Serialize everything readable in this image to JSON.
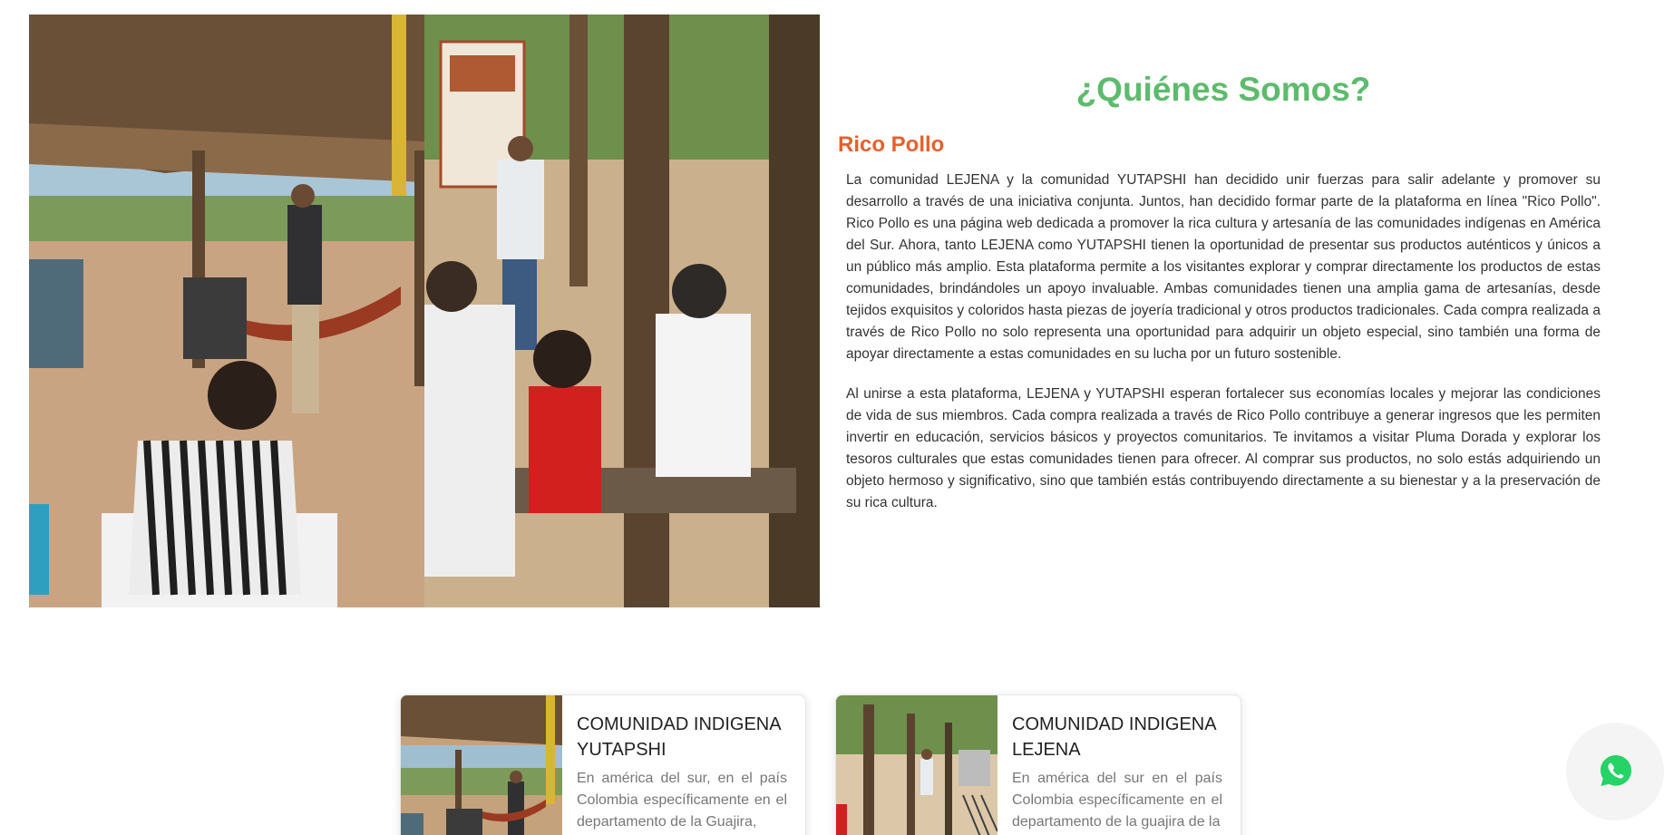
{
  "about": {
    "title": "¿Quiénes Somos?",
    "subtitle": "Rico Pollo",
    "paragraphs": [
      "La comunidad LEJENA y la comunidad YUTAPSHI han decidido unir fuerzas para salir adelante y promover su desarrollo a través de una iniciativa conjunta. Juntos, han decidido formar parte de la plataforma en línea \"Rico Pollo\". Rico Pollo es una página web dedicada a promover la rica cultura y artesanía de las comunidades indígenas en América del Sur. Ahora, tanto LEJENA como YUTAPSHI tienen la oportunidad de presentar sus productos auténticos y únicos a un público más amplio. Esta plataforma permite a los visitantes explorar y comprar directamente los productos de estas comunidades, brindándoles un apoyo invaluable. Ambas comunidades tienen una amplia gama de artesanías, desde tejidos exquisitos y coloridos hasta piezas de joyería tradicional y otros productos tradicionales. Cada compra realizada a través de Rico Pollo no solo representa una oportunidad para adquirir un objeto especial, sino también una forma de apoyar directamente a estas comunidades en su lucha por un futuro sostenible.",
      "Al unirse a esta plataforma, LEJENA y YUTAPSHI esperan fortalecer sus economías locales y mejorar las condiciones de vida de sus miembros. Cada compra realizada a través de Rico Pollo contribuye a generar ingresos que les permiten invertir en educación, servicios básicos y proyectos comunitarios. Te invitamos a visitar Pluma Dorada y explorar los tesoros culturales que estas comunidades tienen para ofrecer. Al comprar sus productos, no solo estás adquiriendo un objeto hermoso y significativo, sino que también estás contribuyendo directamente a su bienestar y a la preservación de su rica cultura."
    ]
  },
  "cards": [
    {
      "title": "COMUNIDAD INDIGENA YUTAPSHI",
      "text": "En américa del sur, en el país Colombia específicamente en el departamento de la Guajira,"
    },
    {
      "title": "COMUNIDAD INDIGENA LEJENA",
      "text": "En américa del sur en el país Colombia específicamente en el departamento de la guajira de la"
    }
  ],
  "icons": {
    "whatsapp": "whatsapp-icon"
  },
  "colors": {
    "title_green": "#5dbb6c",
    "subtitle_orange": "#e5602c",
    "whatsapp_green": "#25d366"
  }
}
